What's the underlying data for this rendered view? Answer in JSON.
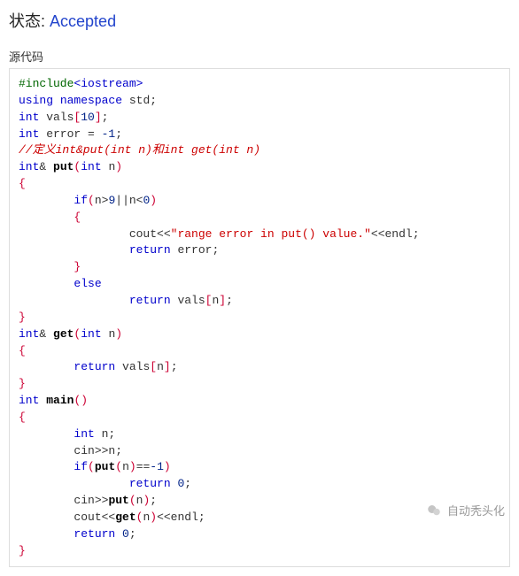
{
  "status": {
    "label": "状态:",
    "value": "Accepted"
  },
  "section_title": "源代码",
  "code": {
    "l1_pp": "#include",
    "l1_inc": "<iostream>",
    "l2_a": "using",
    "l2_b": "namespace",
    "l2_c": " std;",
    "l3_a": "int",
    "l3_b": " vals",
    "l3_ob": "[",
    "l3_n": "10",
    "l3_cb": "]",
    "l3_sc": ";",
    "l4_a": "int",
    "l4_b": " error = ",
    "l4_n": "-1",
    "l4_sc": ";",
    "l5_cmt": "//定义int&put(int n)和int get(int n)",
    "l6_a": "int",
    "l6_amp": "& ",
    "l6_fn": "put",
    "l6_op": "(",
    "l6_t": "int",
    "l6_p": " n",
    "l6_cp": ")",
    "l7": "{",
    "l8_if": "if",
    "l8_op": "(",
    "l8_a": "n>",
    "l8_n1": "9",
    "l8_b": "||n<",
    "l8_n2": "0",
    "l8_cp": ")",
    "l9": "{",
    "l10_a": "cout<<",
    "l10_s": "\"range error in put() value.\"",
    "l10_b": "<<endl;",
    "l11_kw": "return",
    "l11_b": " error;",
    "l12": "}",
    "l13": "else",
    "l14_kw": "return",
    "l14_b": " vals",
    "l14_ob": "[",
    "l14_v": "n",
    "l14_cb": "]",
    "l14_sc": ";",
    "l15": "}",
    "l16_a": "int",
    "l16_amp": "& ",
    "l16_fn": "get",
    "l16_op": "(",
    "l16_t": "int",
    "l16_p": " n",
    "l16_cp": ")",
    "l17": "{",
    "l18_kw": "return",
    "l18_b": " vals",
    "l18_ob": "[",
    "l18_v": "n",
    "l18_cb": "]",
    "l18_sc": ";",
    "l19": "}",
    "l20_a": "int",
    "l20_sp": " ",
    "l20_fn": "main",
    "l20_op": "(",
    "l20_cp": ")",
    "l21": "{",
    "l22_a": "int",
    "l22_b": " n;",
    "l23": "cin>>n;",
    "l24_if": "if",
    "l24_op": "(",
    "l24_fn": "put",
    "l24_op2": "(",
    "l24_v": "n",
    "l24_cp2": ")",
    "l24_eq": "==",
    "l24_n": "-1",
    "l24_cp": ")",
    "l25_kw": "return",
    "l25_sp": " ",
    "l25_n": "0",
    "l25_sc": ";",
    "l26_a": "cin>>",
    "l26_fn": "put",
    "l26_op": "(",
    "l26_v": "n",
    "l26_cp": ")",
    "l26_sc": ";",
    "l27_a": "cout<<",
    "l27_fn": "get",
    "l27_op": "(",
    "l27_v": "n",
    "l27_cp": ")",
    "l27_b": "<<endl;",
    "l28_kw": "return",
    "l28_sp": " ",
    "l28_n": "0",
    "l28_sc": ";",
    "l29": "}"
  },
  "watermark": "自动秃头化"
}
